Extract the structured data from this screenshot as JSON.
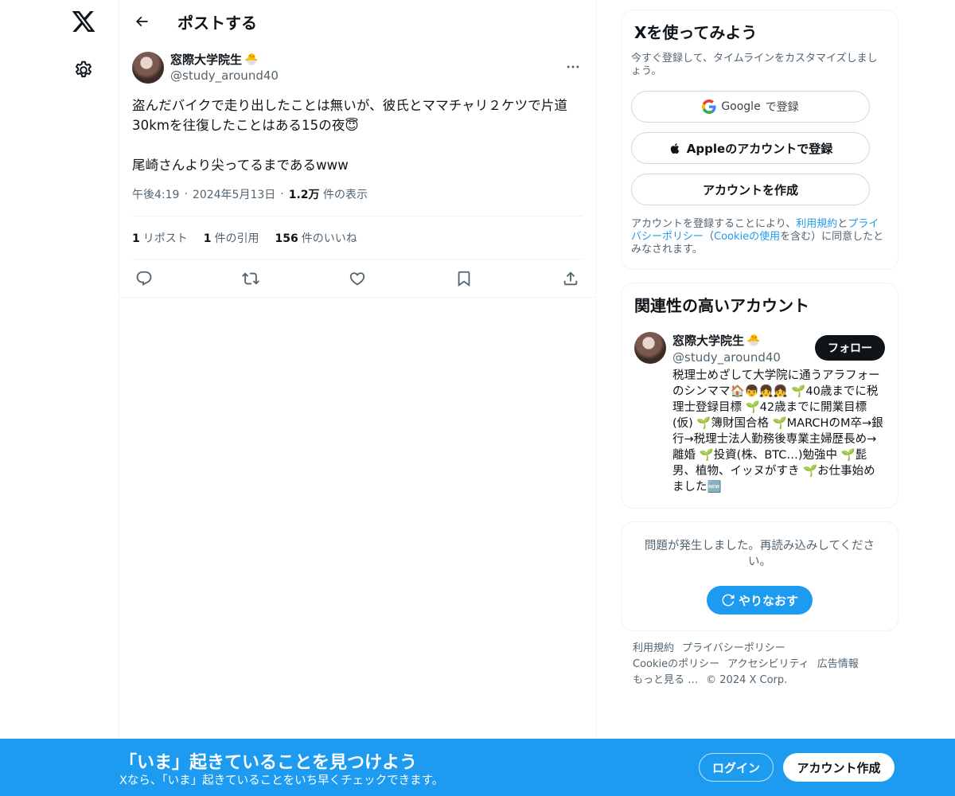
{
  "nav": {
    "logo_icon": "x-logo-icon",
    "settings_icon": "gear-icon"
  },
  "header": {
    "title": "ポストする",
    "back_icon": "arrow-left-icon"
  },
  "post": {
    "author_name": "窓際大学院生",
    "author_emoji": "🐣",
    "author_handle": "@study_around40",
    "text": "盗んだバイクで走り出したことは無いが、彼氏とママチャリ２ケツで片道30kmを往復したことはある15の夜😇\n\n尾崎さんより尖ってるまであるwww",
    "time": "午後4:19",
    "dot1": "·",
    "date": "2024年5月13日",
    "dot2": "·",
    "views_count": "1.2万",
    "views_label": "件の表示",
    "reposts_count": "1",
    "reposts_label": "リポスト",
    "quotes_count": "1",
    "quotes_label": "件の引用",
    "likes_count": "156",
    "likes_label": "件のいいね"
  },
  "signup": {
    "title": "Xを使ってみよう",
    "desc": "今すぐ登録して、タイムラインをカスタマイズしましょう。",
    "google_brand": "Google",
    "google_label": "で登録",
    "apple_label": "Appleのアカウントで登録",
    "create_label": "アカウントを作成",
    "terms_pre": "アカウントを登録することにより、",
    "terms_link1": "利用規約",
    "terms_mid1": "と",
    "terms_link2": "プライバシーポリシー",
    "terms_mid2": "（",
    "terms_link3": "Cookieの使用",
    "terms_post": "を含む）に同意したとみなされます。"
  },
  "related": {
    "title": "関連性の高いアカウント",
    "name": "窓際大学院生",
    "emoji": "🐣",
    "handle": "@study_around40",
    "follow_label": "フォロー",
    "bio": "税理士めざして大学院に通うアラフォーのシンママ🏠👦👧👧 🌱40歳までに税理士登録目標 🌱42歳までに開業目標(仮) 🌱簿財国合格 🌱MARCHのM卒→銀行→税理士法人勤務後専業主婦歴長め→離婚 🌱投資(株、BTC…)勉強中 🌱髭男、植物、イッヌがすき 🌱お仕事始めました🆕"
  },
  "error": {
    "text": "問題が発生しました。再読み込みしてください。",
    "retry_label": "やりなおす"
  },
  "footer": {
    "terms": "利用規約",
    "privacy": "プライバシーポリシー",
    "cookie": "Cookieのポリシー",
    "accessibility": "アクセシビリティ",
    "ads": "広告情報",
    "more": "もっと見る …",
    "copyright": "© 2024 X Corp."
  },
  "bottom": {
    "title": "「いま」起きていることを見つけよう",
    "subtitle": "Xなら、「いま」起きていることをいち早くチェックできます。",
    "login_label": "ログイン",
    "signup_label": "アカウント作成"
  },
  "colors": {
    "accent": "#1d9bf0",
    "text": "#0f1419",
    "muted": "#536471",
    "border": "#eff3f4"
  }
}
